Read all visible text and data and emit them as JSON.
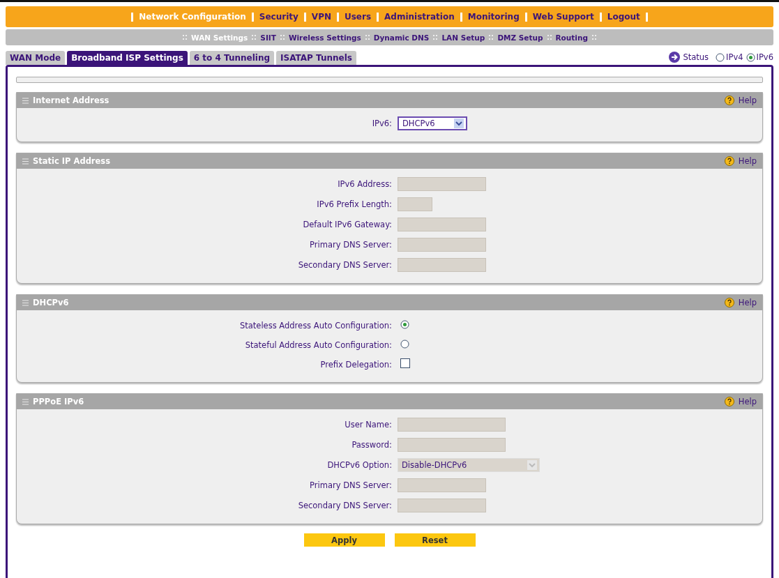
{
  "top_menu": [
    {
      "label": "Network Configuration",
      "selected": true
    },
    {
      "label": "Security",
      "selected": false
    },
    {
      "label": "VPN",
      "selected": false
    },
    {
      "label": "Users",
      "selected": false
    },
    {
      "label": "Administration",
      "selected": false
    },
    {
      "label": "Monitoring",
      "selected": false
    },
    {
      "label": "Web Support",
      "selected": false
    },
    {
      "label": "Logout",
      "selected": false
    }
  ],
  "sub_menu": [
    {
      "label": "WAN Settings",
      "selected": true
    },
    {
      "label": "SIIT",
      "selected": false
    },
    {
      "label": "Wireless Settings",
      "selected": false
    },
    {
      "label": "Dynamic DNS",
      "selected": false
    },
    {
      "label": "LAN Setup",
      "selected": false
    },
    {
      "label": "DMZ Setup",
      "selected": false
    },
    {
      "label": "Routing",
      "selected": false
    }
  ],
  "tabs": [
    {
      "label": "WAN Mode",
      "selected": false
    },
    {
      "label": "Broadband ISP Settings",
      "selected": true
    },
    {
      "label": "6 to 4 Tunneling",
      "selected": false
    },
    {
      "label": "ISATAP Tunnels",
      "selected": false
    }
  ],
  "status_link": "Status",
  "ip_mode": [
    {
      "label": "IPv4",
      "selected": false
    },
    {
      "label": "IPv6",
      "selected": true
    }
  ],
  "sections": [
    {
      "title": "Internet Address",
      "help": "Help",
      "rows": [
        {
          "kind": "select",
          "label": "IPv6:",
          "value": "DHCPv6",
          "disabled": false
        }
      ]
    },
    {
      "title": "Static IP Address",
      "help": "Help",
      "rows": [
        {
          "kind": "text",
          "label": "IPv6 Address:",
          "disabled": true
        },
        {
          "kind": "text",
          "label": "IPv6 Prefix Length:",
          "disabled": true
        },
        {
          "kind": "text",
          "label": "Default IPv6 Gateway:",
          "disabled": true
        },
        {
          "kind": "text",
          "label": "Primary DNS Server:",
          "disabled": true
        },
        {
          "kind": "text",
          "label": "Secondary DNS Server:",
          "disabled": true
        }
      ]
    },
    {
      "title": "DHCPv6",
      "help": "Help",
      "rows": [
        {
          "kind": "radio",
          "label": "Stateless Address Auto Configuration:",
          "selected": true
        },
        {
          "kind": "radio",
          "label": "Stateful Address Auto Configuration:",
          "selected": false
        },
        {
          "kind": "checkbox",
          "label": "Prefix Delegation:",
          "checked": false
        }
      ]
    },
    {
      "title": "PPPoE IPv6",
      "help": "Help",
      "rows": [
        {
          "kind": "text",
          "label": "User Name:",
          "disabled": true
        },
        {
          "kind": "text",
          "label": "Password:",
          "disabled": true
        },
        {
          "kind": "select",
          "label": "DHCPv6 Option:",
          "value": "Disable-DHCPv6",
          "disabled": true
        },
        {
          "kind": "text",
          "label": "Primary DNS Server:",
          "disabled": true
        },
        {
          "kind": "text",
          "label": "Secondary DNS Server:",
          "disabled": true
        }
      ]
    }
  ],
  "buttons": [
    "Apply",
    "Reset"
  ]
}
